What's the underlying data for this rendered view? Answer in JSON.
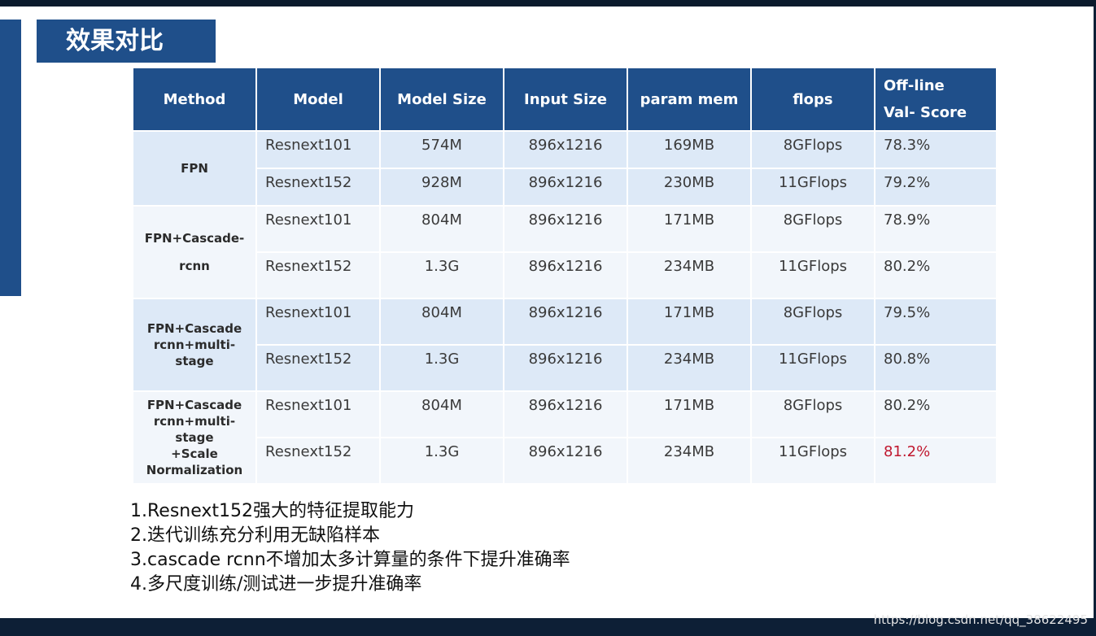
{
  "slide": {
    "title": "效果对比",
    "table": {
      "headers": [
        "Method",
        "Model",
        "Model Size",
        "Input Size",
        "param mem",
        "flops",
        [
          "Off-line",
          "Val- Score"
        ]
      ],
      "groups": [
        {
          "method": [
            "FPN"
          ],
          "rows": [
            {
              "model": "Resnext101",
              "size": "574M",
              "input": "896x1216",
              "mem": "169MB",
              "flops": "8GFlops",
              "score": "78.3%"
            },
            {
              "model": "Resnext152",
              "size": "928M",
              "input": "896x1216",
              "mem": "230MB",
              "flops": "11GFlops",
              "score": "79.2%"
            }
          ]
        },
        {
          "method": [
            "FPN+Cascade-",
            "rcnn"
          ],
          "rows": [
            {
              "model": "Resnext101",
              "size": "804M",
              "input": "896x1216",
              "mem": "171MB",
              "flops": "8GFlops",
              "score": "78.9%"
            },
            {
              "model": "Resnext152",
              "size": "1.3G",
              "input": "896x1216",
              "mem": "234MB",
              "flops": "11GFlops",
              "score": "80.2%"
            }
          ]
        },
        {
          "method": [
            "FPN+Cascade",
            "rcnn+multi-",
            "stage"
          ],
          "rows": [
            {
              "model": "Resnext101",
              "size": "804M",
              "input": "896x1216",
              "mem": "171MB",
              "flops": "8GFlops",
              "score": "79.5%"
            },
            {
              "model": "Resnext152",
              "size": "1.3G",
              "input": "896x1216",
              "mem": "234MB",
              "flops": "11GFlops",
              "score": "80.8%"
            }
          ]
        },
        {
          "method": [
            "FPN+Cascade",
            "rcnn+multi-",
            "stage",
            "+Scale",
            "Normalization"
          ],
          "rows": [
            {
              "model": "Resnext101",
              "size": "804M",
              "input": "896x1216",
              "mem": "171MB",
              "flops": "8GFlops",
              "score": "80.2%"
            },
            {
              "model": "Resnext152",
              "size": "1.3G",
              "input": "896x1216",
              "mem": "234MB",
              "flops": "11GFlops",
              "score": "81.2%"
            }
          ]
        }
      ],
      "best_score_color": "#c0182f"
    },
    "notes": [
      "1.Resnext152强大的特征提取能力",
      "2.迭代训练充分利用无缺陷样本",
      "3.cascade rcnn不增加太多计算量的条件下提升准确率",
      "4.多尺度训练/测试进一步提升准确率"
    ]
  },
  "watermark": "https://blog.csdn.net/qq_38622495",
  "colors": {
    "header_bg": "#1f4f8a",
    "row_light": "#dde9f7",
    "row_lighter": "#f2f6fb"
  }
}
